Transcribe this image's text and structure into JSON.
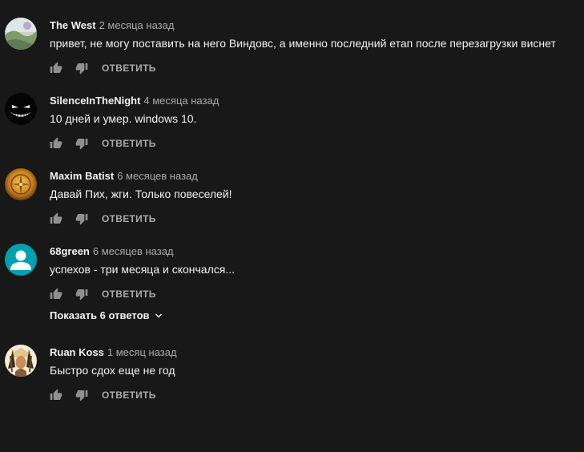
{
  "comments": [
    {
      "author": "The West",
      "time": "2 месяца назад",
      "text": "привет, не могу поставить на него Виндовс, а именно последний етап после перезагрузки виснет",
      "reply_label": "ОТВЕТИТЬ",
      "avatar_icon": "landscape-photo"
    },
    {
      "author": "SilenceInTheNight",
      "time": "4 месяца назад",
      "text": "10 дней и умер. windows 10.",
      "reply_label": "ОТВЕТИТЬ",
      "avatar_icon": "grinning-face-dark"
    },
    {
      "author": "Maxim Batist",
      "time": "6 месяцев назад",
      "text": "Давай Пих, жги. Только повеселей!",
      "reply_label": "ОТВЕТИТЬ",
      "avatar_icon": "golden-compass"
    },
    {
      "author": "68green",
      "time": "6 месяцев назад",
      "text": "успехов - три месяца и скончался...",
      "reply_label": "ОТВЕТИТЬ",
      "avatar_icon": "default-user-silhouette",
      "show_replies_label": "Показать 6 ответов"
    },
    {
      "author": "Ruan Koss",
      "time": "1 месяц назад",
      "text": "Быстро сдох еще не год",
      "reply_label": "ОТВЕТИТЬ",
      "avatar_icon": "native-headdress-portrait"
    }
  ],
  "colors": {
    "background": "#181818",
    "primary_text": "#f1f1f1",
    "secondary_text": "#aaaaaa",
    "default_avatar": "#00a0b0"
  }
}
